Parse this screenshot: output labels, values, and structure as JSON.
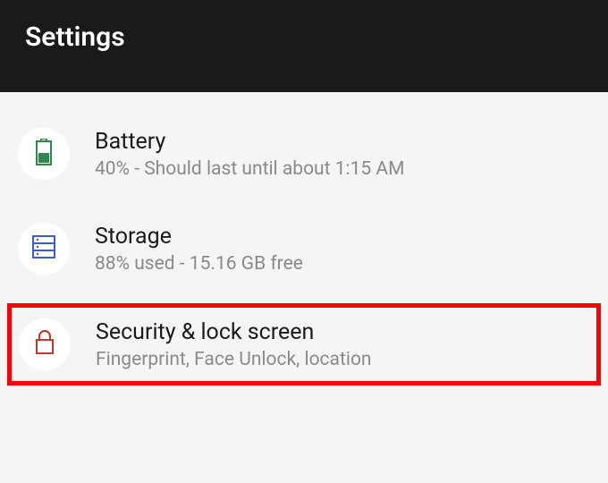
{
  "header": {
    "title": "Settings"
  },
  "items": [
    {
      "title": "Battery",
      "subtitle": "40% - Should last until about 1:15 AM"
    },
    {
      "title": "Storage",
      "subtitle": "88% used - 15.16 GB free"
    },
    {
      "title": "Security & lock screen",
      "subtitle": "Fingerprint, Face Unlock, location"
    }
  ]
}
